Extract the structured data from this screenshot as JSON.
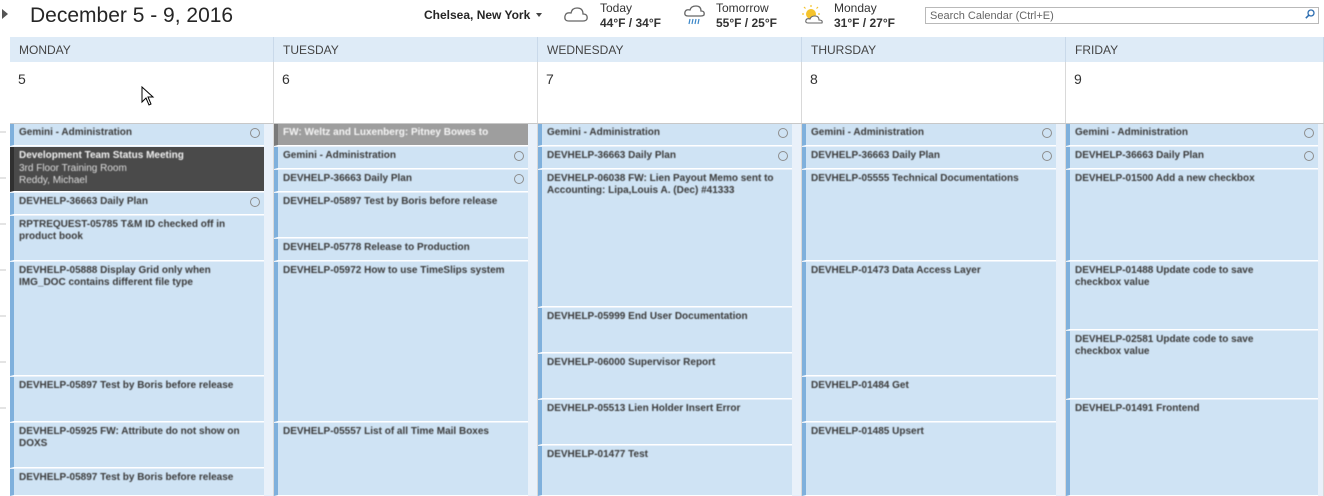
{
  "header": {
    "date_range": "December 5 - 9, 2016",
    "location": "Chelsea, New York",
    "weather": [
      {
        "label": "Today",
        "temp": "44°F / 34°F",
        "icon": "cloud-icon"
      },
      {
        "label": "Tomorrow",
        "temp": "55°F / 25°F",
        "icon": "rain-icon"
      },
      {
        "label": "Monday",
        "temp": "31°F / 27°F",
        "icon": "partly-sunny-icon"
      }
    ],
    "search_placeholder": "Search Calendar (Ctrl+E)"
  },
  "days": [
    {
      "name": "MONDAY",
      "num": "5"
    },
    {
      "name": "TUESDAY",
      "num": "6"
    },
    {
      "name": "WEDNESDAY",
      "num": "7"
    },
    {
      "name": "THURSDAY",
      "num": "8"
    },
    {
      "name": "FRIDAY",
      "num": "9"
    }
  ],
  "events": {
    "mon": [
      "Gemini - Administration",
      "Development Team Status Meeting",
      "3rd Floor Training Room",
      "Reddy, Michael",
      "DEVHELP-36663 Daily Plan",
      "RPTREQUEST-05785 T&M ID checked off in product book",
      "DEVHELP-05888 Display Grid only when IMG_DOC contains different file type",
      "DEVHELP-05897 Test by Boris before release",
      "DEVHELP-05925 FW: Attribute do not show on DOXS",
      "DEVHELP-05897 Test by Boris before release"
    ],
    "tue": [
      "FW: Weltz and Luxenberg: Pitney Bowes to",
      "Gemini - Administration",
      "DEVHELP-36663 Daily Plan",
      "DEVHELP-05897 Test by Boris before release",
      "DEVHELP-05778 Release to Production",
      "DEVHELP-05972 How to use TimeSlips system",
      "DEVHELP-05557 List of all Time Mail Boxes"
    ],
    "wed": [
      "Gemini - Administration",
      "DEVHELP-36663 Daily Plan",
      "DEVHELP-06038 FW: Lien Payout Memo sent to Accounting: Lipa,Louis A. (Dec) #41333",
      "DEVHELP-05999 End User Documentation",
      "DEVHELP-06000 Supervisor Report",
      "DEVHELP-05513 Lien Holder Insert Error",
      "DEVHELP-01477 Test"
    ],
    "thu": [
      "Gemini - Administration",
      "DEVHELP-36663 Daily Plan",
      "DEVHELP-05555 Technical Documentations",
      "DEVHELP-01473 Data Access Layer",
      "DEVHELP-01484 Get",
      "DEVHELP-01485 Upsert"
    ],
    "fri": [
      "Gemini - Administration",
      "DEVHELP-36663 Daily Plan",
      "DEVHELP-01500 Add a new checkbox",
      "DEVHELP-01488 Update code to save checkbox value",
      "DEVHELP-02581 Update code to save checkbox value",
      "DEVHELP-01491 Frontend"
    ]
  },
  "colors": {
    "event_bg": "#cfe3f4",
    "event_bar": "#7fb0dc",
    "header_bg": "#deebf7",
    "dark_event": "#4a4a4a"
  }
}
